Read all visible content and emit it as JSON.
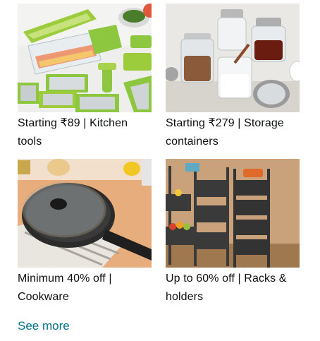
{
  "tiles": [
    {
      "caption": "Starting ₹89 | Kitchen tools",
      "image": "kitchen-tools-image"
    },
    {
      "caption": "Starting ₹279 | Storage containers",
      "image": "storage-containers-image"
    },
    {
      "caption": "Minimum 40% off | Cookware",
      "image": "cookware-image"
    },
    {
      "caption": "Up to 60% off | Racks & holders",
      "image": "racks-holders-image"
    }
  ],
  "see_more": "See more",
  "colors": {
    "link": "#007185",
    "text": "#0f1111",
    "accent_green": "#8dc63f"
  }
}
